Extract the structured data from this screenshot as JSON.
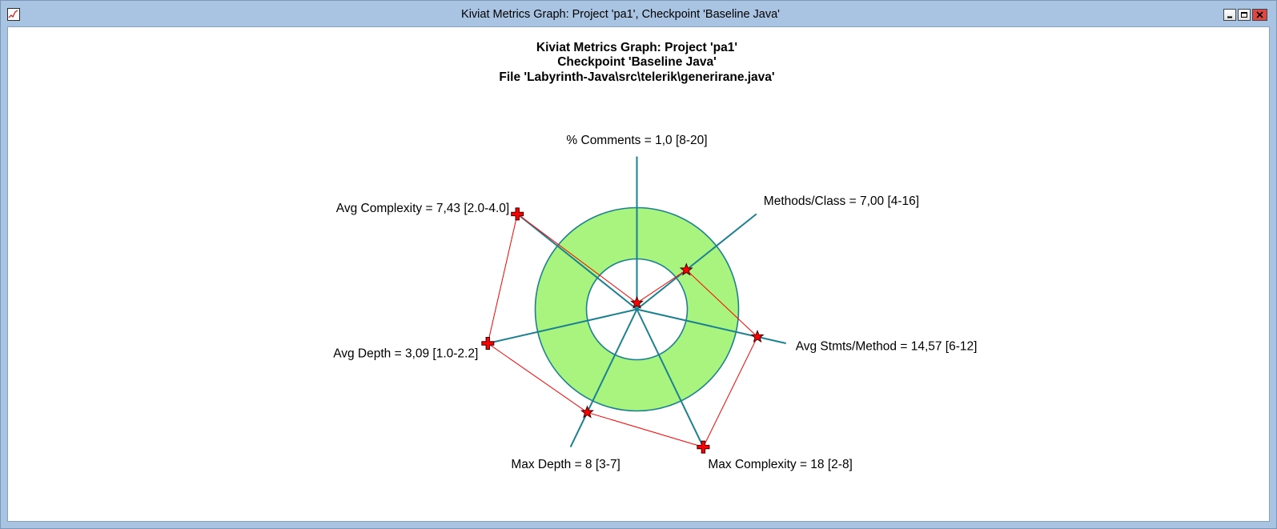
{
  "window": {
    "title": "Kiviat Metrics Graph: Project 'pa1', Checkpoint 'Baseline Java'",
    "icons": {
      "app": "graph-icon",
      "minimize": "minimize-icon",
      "maximize": "maximize-icon",
      "close": "close-icon"
    },
    "colors": {
      "frame": "#a9c4e2",
      "close_button": "#e0463f"
    }
  },
  "chart_data": {
    "type": "radar",
    "title_lines": [
      "Kiviat Metrics Graph: Project 'pa1'",
      "Checkpoint 'Baseline Java'",
      "File 'Labyrinth-Java\\src\\telerik\\generirane.java'"
    ],
    "axes": [
      {
        "label": "% Comments = 1,0 [8-20]",
        "value": 1.0,
        "range": [
          8,
          20
        ],
        "marker": "star-marker"
      },
      {
        "label": "Methods/Class = 7,00 [4-16]",
        "value": 7.0,
        "range": [
          4,
          16
        ],
        "marker": "star-marker"
      },
      {
        "label": "Avg Stmts/Method = 14,57 [6-12]",
        "value": 14.57,
        "range": [
          6,
          12
        ],
        "marker": "star-marker"
      },
      {
        "label": "Max Complexity = 18 [2-8]",
        "value": 18,
        "range": [
          2,
          8
        ],
        "marker": "cross-marker"
      },
      {
        "label": "Max Depth = 8 [3-7]",
        "value": 8,
        "range": [
          3,
          7
        ],
        "marker": "star-marker"
      },
      {
        "label": "Avg Depth = 3,09 [1.0-2.2]",
        "value": 3.09,
        "range": [
          1.0,
          2.2
        ],
        "marker": "cross-marker"
      },
      {
        "label": "Avg Complexity = 7,43 [2.0-4.0]",
        "value": 7.43,
        "range": [
          2.0,
          4.0
        ],
        "marker": "cross-marker"
      }
    ],
    "colors": {
      "range_band": "#a9f47e",
      "axis": "#1b8190",
      "polygon": "#ff0000",
      "marker": "#ff0000",
      "marker_outline": "#3a0000"
    }
  }
}
